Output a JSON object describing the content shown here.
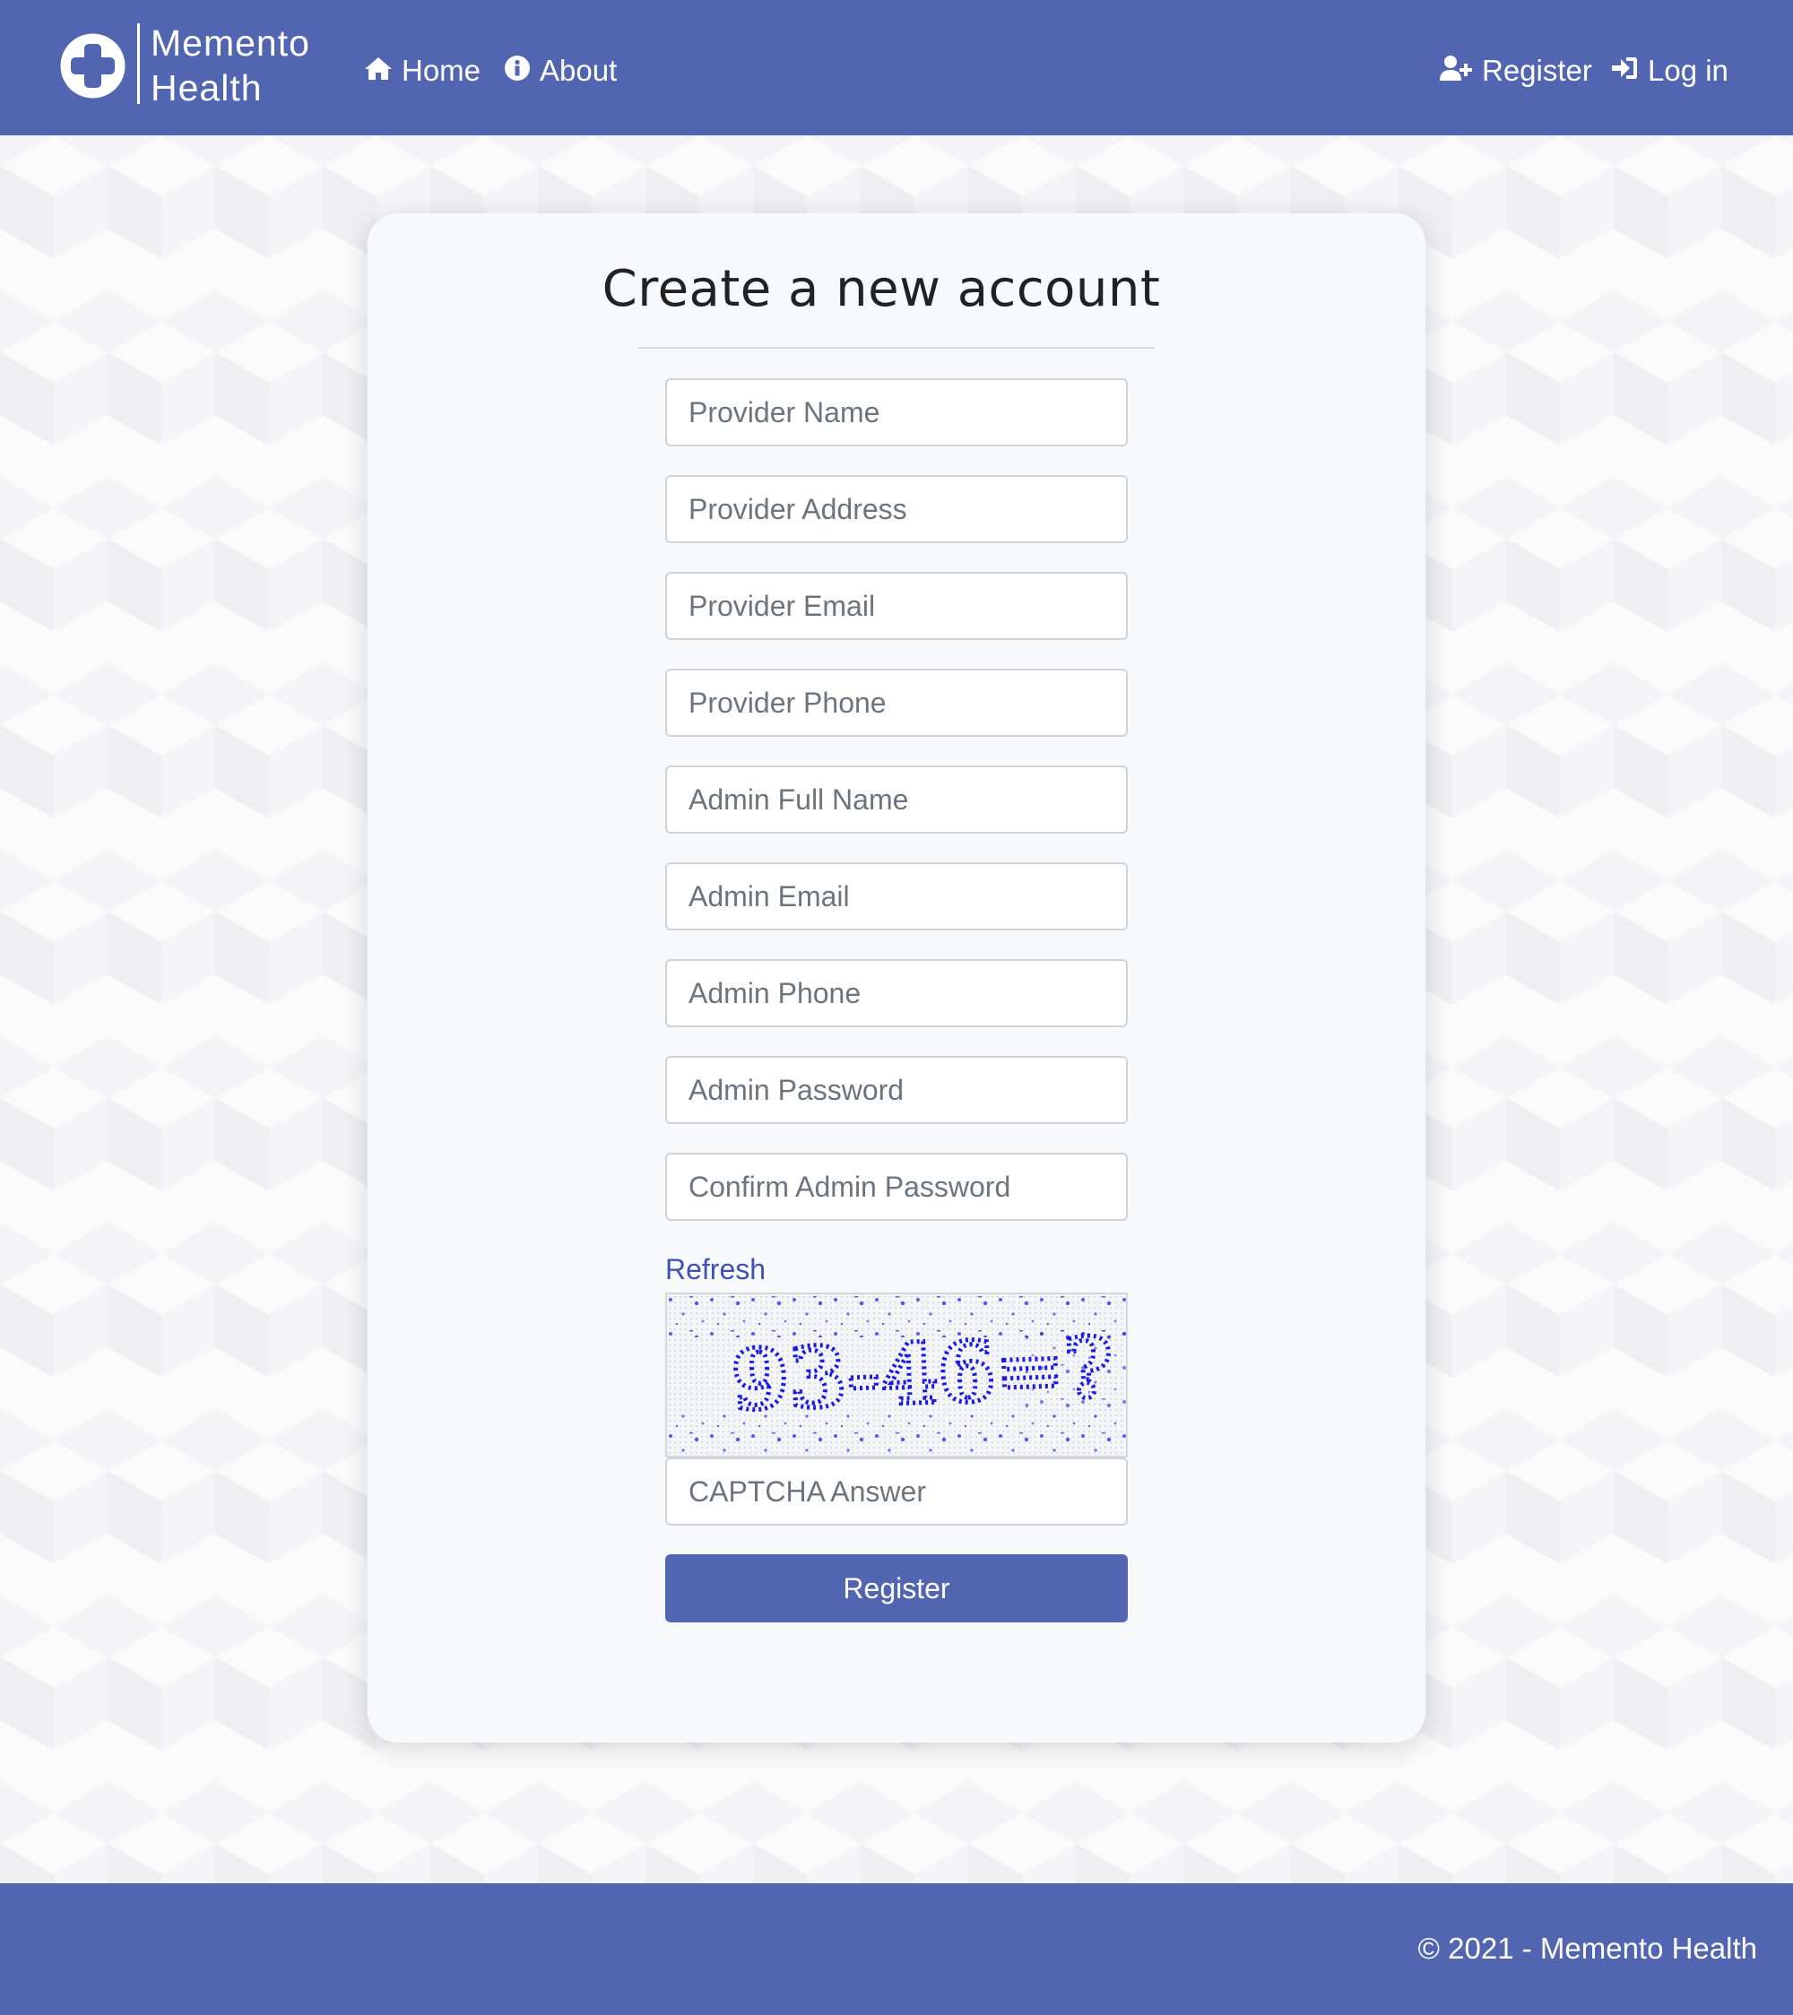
{
  "brand": {
    "line1": "Memento",
    "line2": "Health",
    "icon": "medical-cross-icon"
  },
  "nav": {
    "home_label": "Home",
    "about_label": "About",
    "register_label": "Register",
    "login_label": "Log in",
    "icons": {
      "home": "home-icon",
      "about": "info-circle-icon",
      "register": "user-plus-icon",
      "login": "sign-in-icon"
    }
  },
  "form": {
    "title": "Create a new account",
    "fields": {
      "provider_name": "Provider Name",
      "provider_address": "Provider Address",
      "provider_email": "Provider Email",
      "provider_phone": "Provider Phone",
      "admin_full_name": "Admin Full Name",
      "admin_email": "Admin Email",
      "admin_phone": "Admin Phone",
      "admin_password": "Admin Password",
      "confirm_admin_password": "Confirm Admin Password",
      "captcha_answer": "CAPTCHA Answer"
    },
    "refresh_label": "Refresh",
    "captcha_text": "93-46=?",
    "submit_label": "Register"
  },
  "footer": {
    "text": "© 2021 - Memento Health"
  },
  "colors": {
    "primary": "#5165b0",
    "link": "#3f51b5",
    "captcha_ink": "#1a1ae0"
  }
}
